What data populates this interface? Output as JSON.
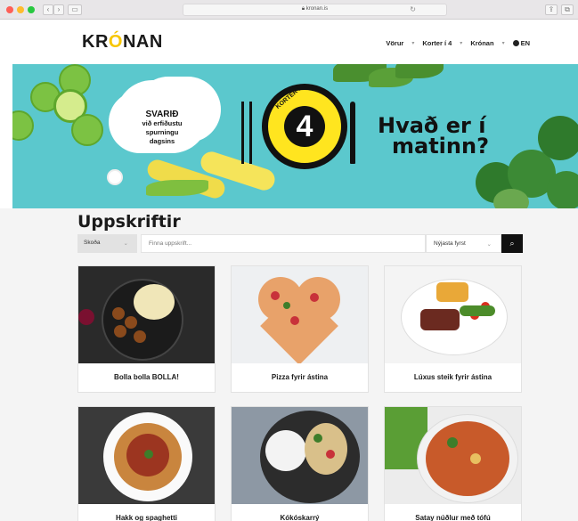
{
  "browser": {
    "url": "kronan.is"
  },
  "header": {
    "logo": {
      "pre": "KR",
      "accent": "Ó",
      "post": "NAN"
    },
    "nav": [
      {
        "label": "Vörur"
      },
      {
        "label": "Korter í 4"
      },
      {
        "label": "Krónan"
      },
      {
        "label": "EN"
      }
    ]
  },
  "banner": {
    "cloud_title": "SVARIÐ",
    "cloud_line1": "við erfiðustu",
    "cloud_line2": "spurningu",
    "cloud_line3": "dagsins",
    "badge_word": "KORTER Í",
    "badge_number": "4",
    "headline_line1": "Hvað er í",
    "headline_line2": "matinn?"
  },
  "recipes": {
    "title": "Uppskriftir",
    "filter_label": "Skoða",
    "search_placeholder": "Finna uppskrift...",
    "sort_label": "Nýjasta fyrst",
    "cards": [
      {
        "label": "Bolla bolla BOLLA!"
      },
      {
        "label": "Pizza fyrir ástina"
      },
      {
        "label": "Lúxus steik fyrir ástina"
      },
      {
        "label": "Hakk og spaghetti"
      },
      {
        "label": "Kókóskarrý"
      },
      {
        "label": "Satay núðlur með tófú"
      }
    ]
  }
}
